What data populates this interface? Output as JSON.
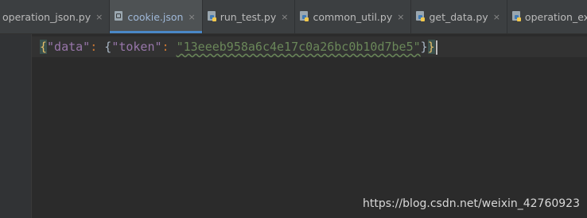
{
  "tabs": [
    {
      "label": "operation_json.py",
      "close": "×",
      "active": false,
      "type": "py"
    },
    {
      "label": "cookie.json",
      "close": "×",
      "active": true,
      "type": "json"
    },
    {
      "label": "run_test.py",
      "close": "×",
      "active": false,
      "type": "py"
    },
    {
      "label": "common_util.py",
      "close": "×",
      "active": false,
      "type": "py"
    },
    {
      "label": "get_data.py",
      "close": "×",
      "active": false,
      "type": "py"
    },
    {
      "label": "operation_excel.py",
      "close": "×",
      "active": false,
      "type": "py"
    }
  ],
  "editor": {
    "open_brace": "{",
    "key1": "\"data\"",
    "colon1": ": ",
    "inner_open": "{",
    "key2": "\"token\"",
    "colon2": ": ",
    "value": "\"13eeeb958a6c4e17c0a26bc0b10d7be5\"",
    "inner_close": "}",
    "close_brace": "}"
  },
  "watermark": "https://blog.csdn.net/weixin_42760923"
}
